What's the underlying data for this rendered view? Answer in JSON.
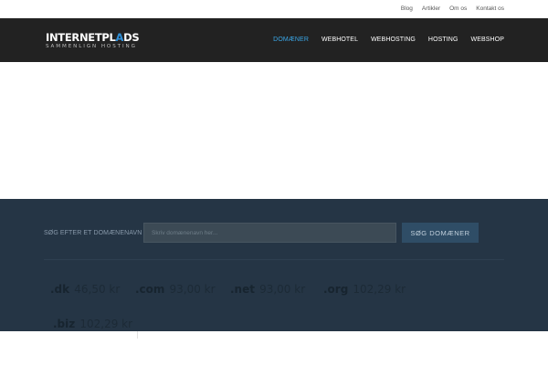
{
  "top_links": [
    "Blog",
    "Artikler",
    "Om os",
    "Kontakt os"
  ],
  "logo": {
    "part_white": "INTERNETPL",
    "part_blue": "A",
    "part_white_2": "DS",
    "tagline": "SAMMENLIGN HOSTING"
  },
  "nav": {
    "items": [
      "DOMÆNER",
      "WEBHOTEL",
      "WEBHOSTING",
      "HOSTING",
      "WEBSHOP"
    ],
    "active_index": 0
  },
  "search": {
    "label": "SØG EFTER ET DOMÆNENAVN",
    "placeholder": "Skriv domænenavn her...",
    "button_label": "SØG DOMÆNER"
  },
  "tlds": [
    {
      "name": ".dk",
      "price": "46,50 kr"
    },
    {
      "name": ".com",
      "price": "93,00 kr"
    },
    {
      "name": ".net",
      "price": "93,00 kr"
    },
    {
      "name": ".org",
      "price": "102,29 kr"
    },
    {
      "name": ".biz",
      "price": "102,29 kr"
    }
  ],
  "colors": {
    "header_bg": "#222222",
    "accent": "#3aa6e6",
    "search_section_bg": "#253545",
    "button_bg": "#2f4d66"
  }
}
